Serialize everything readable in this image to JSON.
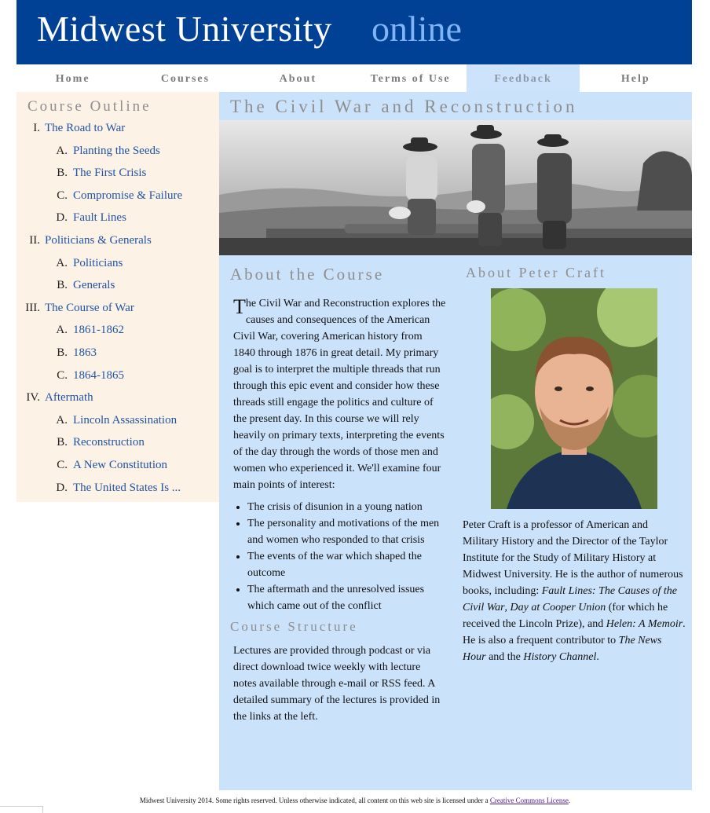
{
  "header": {
    "title": "Midwest University",
    "subtitle": "online"
  },
  "nav": [
    "Home",
    "Courses",
    "About",
    "Terms of Use",
    "Feedback",
    "Help"
  ],
  "nav_active": "Feedback",
  "sidebar": {
    "heading": "Course Outline",
    "items": [
      {
        "num": "I.",
        "label": "The Road to War",
        "level": 1
      },
      {
        "num": "A.",
        "label": "Planting the Seeds",
        "level": 2
      },
      {
        "num": "B.",
        "label": "The First Crisis",
        "level": 2
      },
      {
        "num": "C.",
        "label": "Compromise & Failure",
        "level": 2
      },
      {
        "num": "D.",
        "label": "Fault Lines",
        "level": 2
      },
      {
        "num": "II.",
        "label": "Politicians & Generals",
        "level": 1
      },
      {
        "num": "A.",
        "label": "Politicians",
        "level": 2
      },
      {
        "num": "B.",
        "label": "Generals",
        "level": 2
      },
      {
        "num": "III.",
        "label": "The Course of War",
        "level": 1
      },
      {
        "num": "A.",
        "label": "1861-1862",
        "level": 2
      },
      {
        "num": "B.",
        "label": "1863",
        "level": 2
      },
      {
        "num": "C.",
        "label": "1864-1865",
        "level": 2
      },
      {
        "num": "IV.",
        "label": "Aftermath",
        "level": 1
      },
      {
        "num": "A.",
        "label": "Lincoln Assassination",
        "level": 2
      },
      {
        "num": "B.",
        "label": "Reconstruction",
        "level": 2
      },
      {
        "num": "C.",
        "label": "A New Constitution",
        "level": 2
      },
      {
        "num": "D.",
        "label": "The United States Is ...",
        "level": 2
      }
    ]
  },
  "main": {
    "title": "The Civil War and Reconstruction",
    "about": {
      "heading": "About the Course",
      "drop_cap": "T",
      "intro_rest": "he Civil War and Reconstruction explores the causes and consequences of the American Civil War, covering American history from 1840 through 1876 in great detail. My primary goal is to interpret the multiple threads that run through this epic event and consider how these threads still engage the politics and culture of the present day. In this course we will rely heavily on primary texts, interpreting the events of the day through the words of those men and women who experienced it. We'll examine four main points of interest:",
      "bullets": [
        "The crisis of disunion in a young nation",
        "The personality and motivations of the men and women who responded to that crisis",
        "The events of the war which shaped the outcome",
        "The aftermath and the unresolved issues which came out of the conflict"
      ]
    },
    "structure": {
      "heading": "Course Structure",
      "text": "Lectures are provided through podcast or via direct download twice weekly with lecture notes available through e-mail or RSS feed. A detailed summary of the lectures is provided in the links at the left."
    },
    "instructor": {
      "heading": "About Peter Craft",
      "bio_1": "Peter Craft is a professor of American and Military History and the Director of the Taylor Institute for the Study of Military History at Midwest University. He is the author of numerous books, including: ",
      "book_1": "Fault Lines: The Causes of the Civil War",
      "sep_1": ", ",
      "book_2": "Day at Cooper Union",
      "bio_2": " (for which he received the Lincoln Prize), and ",
      "book_3": "Helen: A Memoir",
      "bio_3": ". He is also a frequent contributor to ",
      "show_1": "The News Hour",
      "bio_4": " and the ",
      "show_2": "History Channel",
      "bio_5": "."
    }
  },
  "footer": {
    "text": "Midwest University 2014. Some rights reserved. Unless otherwise indicated, all content on this web site is licensed under a ",
    "link": "Creative Commons License",
    "end": "."
  },
  "colors": {
    "banner": "#004196",
    "accent": "#7fb4f7",
    "main_bg": "#cbe2fb",
    "sidebar_bg": "#fdf2e6",
    "link": "#2054a4"
  }
}
